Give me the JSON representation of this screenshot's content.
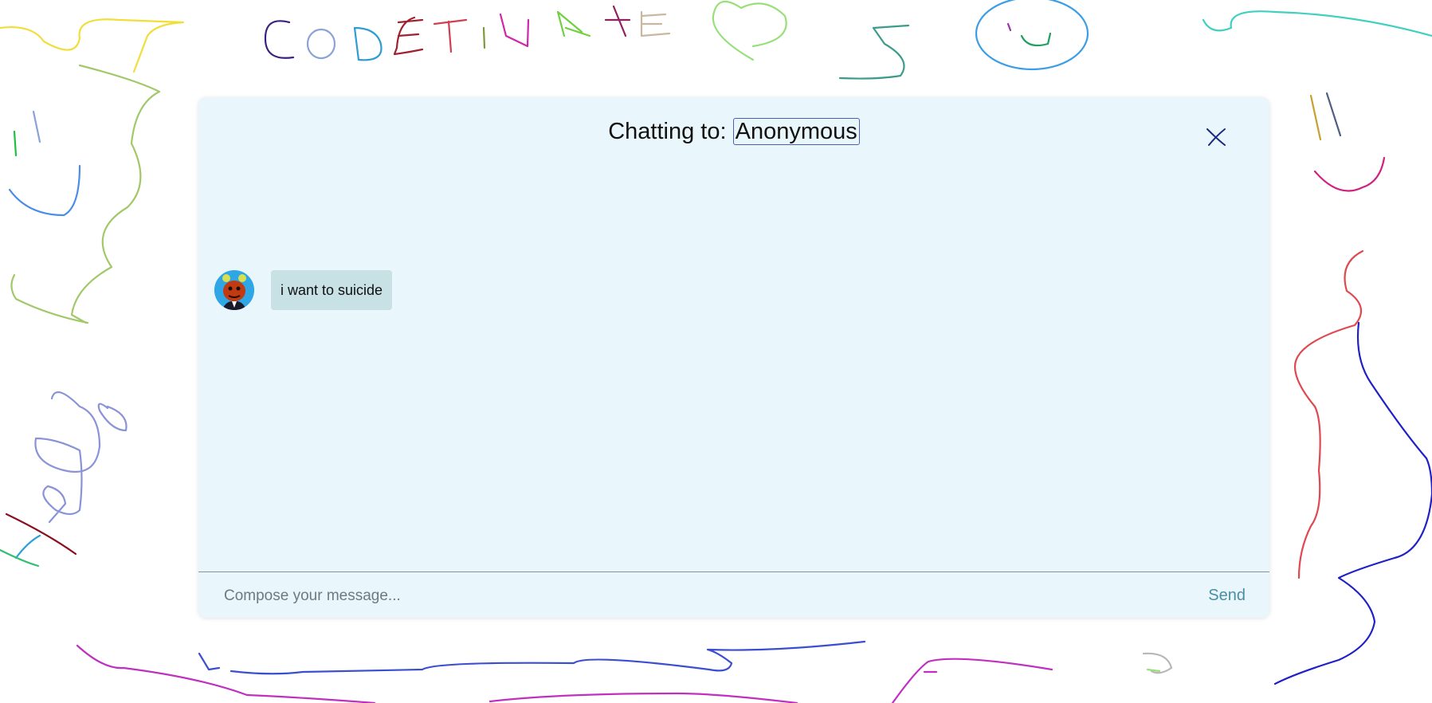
{
  "chat": {
    "title_prefix": "Chatting to:",
    "partner_name": "Anonymous",
    "close_icon": "close-icon",
    "messages": [
      {
        "text": "i want to suicide",
        "avatar": "cartoon-avatar-icon"
      }
    ],
    "composer": {
      "placeholder": "Compose your message...",
      "value": "",
      "send_label": "Send"
    }
  },
  "background": {
    "handwritten_text": "CODETINATE"
  },
  "colors": {
    "window_bg": "#e9f6fb",
    "bubble_bg": "#c7e1e5",
    "send_text": "#4a8ea6",
    "name_border": "#4a5fb5"
  }
}
